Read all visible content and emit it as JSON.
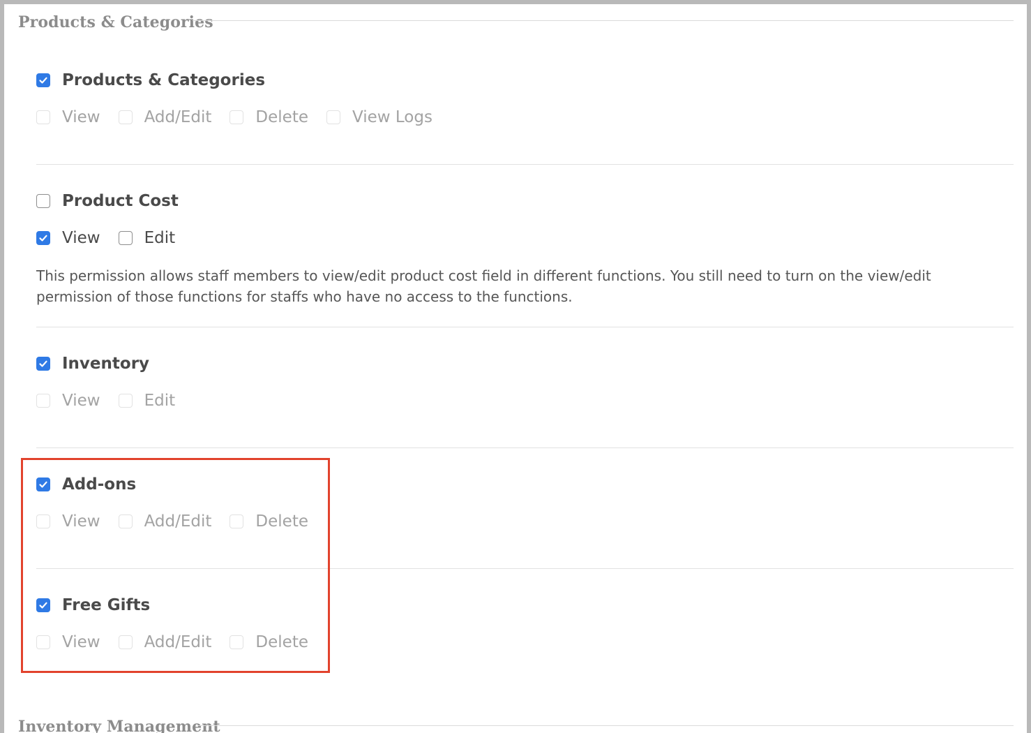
{
  "fieldsets": {
    "products_categories": {
      "legend": "Products & Categories"
    },
    "inventory_management": {
      "legend": "Inventory Management"
    }
  },
  "sections": [
    {
      "title": "Products & Categories",
      "checked": true,
      "options": [
        {
          "label": "View",
          "checked": false,
          "disabled": true
        },
        {
          "label": "Add/Edit",
          "checked": false,
          "disabled": true
        },
        {
          "label": "Delete",
          "checked": false,
          "disabled": true
        },
        {
          "label": "View Logs",
          "checked": false,
          "disabled": true
        }
      ]
    },
    {
      "title": "Product Cost",
      "checked": false,
      "options": [
        {
          "label": "View",
          "checked": true,
          "disabled": false
        },
        {
          "label": "Edit",
          "checked": false,
          "disabled": false
        }
      ],
      "description": "This permission allows staff members to view/edit product cost field in different functions. You still need to turn on the view/edit permission of those functions for staffs who have no access to the functions."
    },
    {
      "title": "Inventory",
      "checked": true,
      "options": [
        {
          "label": "View",
          "checked": false,
          "disabled": true
        },
        {
          "label": "Edit",
          "checked": false,
          "disabled": true
        }
      ]
    },
    {
      "title": "Add-ons",
      "checked": true,
      "options": [
        {
          "label": "View",
          "checked": false,
          "disabled": true
        },
        {
          "label": "Add/Edit",
          "checked": false,
          "disabled": true
        },
        {
          "label": "Delete",
          "checked": false,
          "disabled": true
        }
      ]
    },
    {
      "title": "Free Gifts",
      "checked": true,
      "options": [
        {
          "label": "View",
          "checked": false,
          "disabled": true
        },
        {
          "label": "Add/Edit",
          "checked": false,
          "disabled": true
        },
        {
          "label": "Delete",
          "checked": false,
          "disabled": true
        }
      ]
    }
  ],
  "colors": {
    "accent": "#2f7ae5",
    "highlight": "#e2432d",
    "text": "#4a4a4a",
    "disabled_text": "#a3a3a3"
  }
}
